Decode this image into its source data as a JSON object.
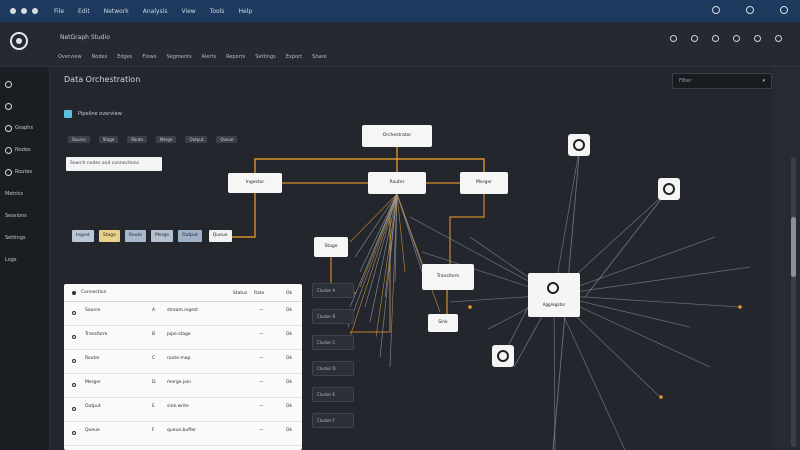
{
  "window": {
    "menu": [
      "File",
      "Edit",
      "Network",
      "Analysis",
      "View",
      "Tools",
      "Help"
    ]
  },
  "header": {
    "app_title": "NetGraph Studio",
    "subnav": [
      "Overview",
      "Nodes",
      "Edges",
      "Flows",
      "Segments",
      "Alerts",
      "Reports",
      "Settings",
      "Export",
      "Share"
    ]
  },
  "sidebar": {
    "items": [
      {
        "label": "",
        "icon": "home-icon"
      },
      {
        "label": "",
        "icon": "network-icon"
      },
      {
        "label": "Graphs",
        "icon": "graph-icon"
      },
      {
        "label": "Nodes",
        "icon": "node-icon"
      },
      {
        "label": "Routes",
        "icon": "route-icon"
      },
      {
        "label": "Metrics",
        "icon": "metric-icon"
      },
      {
        "label": "Sessions",
        "icon": "session-icon"
      },
      {
        "label": "Settings",
        "icon": "gear-icon"
      },
      {
        "label": "Logs",
        "icon": "log-icon"
      }
    ]
  },
  "main": {
    "page_title": "Data Orchestration",
    "search_placeholder": "Filter",
    "panel_title": "Pipeline overview",
    "tabs": [
      "Source",
      "Stage",
      "Route",
      "Merge",
      "Output",
      "Queue"
    ],
    "filter_value": "Search nodes and connections",
    "chips": [
      {
        "label": "Ingest",
        "color": "#b9c7d9"
      },
      {
        "label": "Stage",
        "color": "#e8d28a"
      },
      {
        "label": "Route",
        "color": "#a9b8cc"
      },
      {
        "label": "Merge",
        "color": "#b4c0d0"
      },
      {
        "label": "Output",
        "color": "#9fb1c8"
      },
      {
        "label": "Queue",
        "color": "#f2f2f2"
      }
    ],
    "side_chips": [
      "Cluster A",
      "Cluster B",
      "Cluster C",
      "Cluster D",
      "Cluster E",
      "Cluster F"
    ],
    "table": {
      "headers": [
        "Connection",
        "Status",
        "Rate",
        "Ok"
      ],
      "rows": [
        {
          "c1": "Source",
          "c2": "A",
          "c3": "stream.ingest",
          "c4": "—",
          "c5": "Ok"
        },
        {
          "c1": "Transform",
          "c2": "B",
          "c3": "pipe.stage",
          "c4": "—",
          "c5": "Ok"
        },
        {
          "c1": "Router",
          "c2": "C",
          "c3": "route.map",
          "c4": "—",
          "c5": "Ok"
        },
        {
          "c1": "Merger",
          "c2": "D",
          "c3": "merge.join",
          "c4": "—",
          "c5": "Ok"
        },
        {
          "c1": "Output",
          "c2": "E",
          "c3": "sink.write",
          "c4": "—",
          "c5": "Ok"
        },
        {
          "c1": "Queue",
          "c2": "F",
          "c3": "queue.buffer",
          "c4": "—",
          "c5": "Ok"
        }
      ]
    }
  },
  "graph": {
    "nodes": {
      "root": "Orchestrator",
      "left": "Ingestor",
      "center": "Router",
      "right": "Merger",
      "small": "Stage",
      "mid": "Transform",
      "low": "Sink",
      "hub": "Aggregator"
    },
    "colors": {
      "edge_orange": "#e89a2c",
      "edge_gray": "#9aa3ad"
    }
  }
}
